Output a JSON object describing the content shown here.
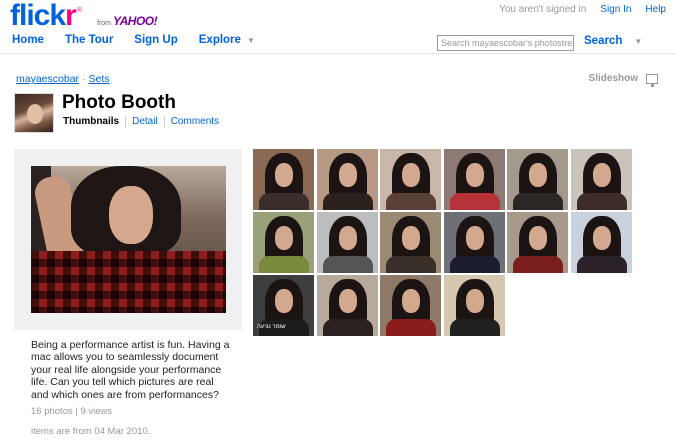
{
  "header": {
    "logo": {
      "part1": "flick",
      "part2": "r",
      "reg": "®",
      "from": "from",
      "yahoo": "YAHOO!"
    },
    "status": "You aren't signed in",
    "sign_in": "Sign In",
    "help": "Help",
    "nav": [
      "Home",
      "The Tour",
      "Sign Up",
      "Explore"
    ],
    "search_placeholder": "Search mayaescobar's photostre",
    "search_button": "Search"
  },
  "breadcrumb": {
    "user": "mayaescobar",
    "sep": "·",
    "sets": "Sets"
  },
  "slideshow": "Slideshow",
  "set": {
    "title": "Photo Booth",
    "views": {
      "thumbnails": "Thumbnails",
      "detail": "Detail",
      "comments": "Comments"
    },
    "description": "Being a performance artist is fun. Having a mac allows you to seamlessly document your real life alongside your performance life. Can you tell which pictures are real and which ones are from performances?",
    "stats": "16 photos | 9 views",
    "dates": "items are from 04 Mar 2010."
  },
  "thumbnails": [
    {
      "bg": "#8a6a55",
      "body": "#3a2e2a",
      "caption": ""
    },
    {
      "bg": "#b79a86",
      "body": "#2a201c",
      "caption": ""
    },
    {
      "bg": "#c8b7a8",
      "body": "#5a4035",
      "caption": ""
    },
    {
      "bg": "#8e7a74",
      "body": "#b8323a",
      "caption": ""
    },
    {
      "bg": "#a39a8e",
      "body": "#2c2624",
      "caption": ""
    },
    {
      "bg": "#c9c3bb",
      "body": "#3c2d28",
      "caption": ""
    },
    {
      "bg": "#9aa07a",
      "body": "#7a8a3c",
      "caption": ""
    },
    {
      "bg": "#bdbdbd",
      "body": "#555555",
      "caption": ""
    },
    {
      "bg": "#9a8a74",
      "body": "#3a302a",
      "caption": ""
    },
    {
      "bg": "#6f6f78",
      "body": "#1d1d30",
      "caption": ""
    },
    {
      "bg": "#a8998c",
      "body": "#7a1e1e",
      "caption": ""
    },
    {
      "bg": "#c9d2dc",
      "body": "#2a2228",
      "caption": ""
    },
    {
      "bg": "#3e3e3e",
      "body": "#1c1c1c",
      "caption": "שומר נגיעה"
    },
    {
      "bg": "#b7aa9c",
      "body": "#2a2221",
      "caption": ""
    },
    {
      "bg": "#8f7a6a",
      "body": "#8a1c1c",
      "caption": ""
    },
    {
      "bg": "#d6c7b0",
      "body": "#202020",
      "caption": ""
    }
  ]
}
